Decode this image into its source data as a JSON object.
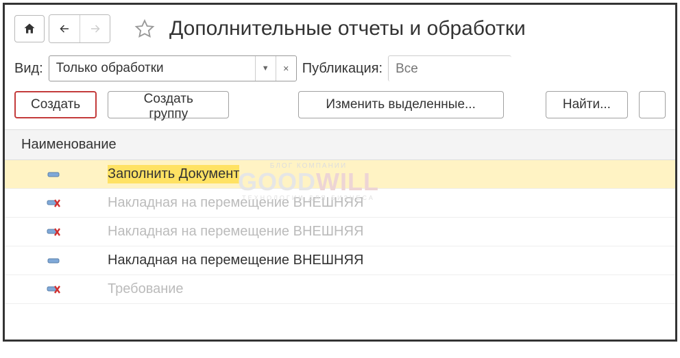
{
  "header": {
    "title": "Дополнительные отчеты и обработки"
  },
  "filter": {
    "type_label": "Вид:",
    "type_value": "Только обработки",
    "pub_label": "Публикация:",
    "pub_placeholder": "Все"
  },
  "toolbar": {
    "create": "Создать",
    "create_group": "Создать группу",
    "change_selected": "Изменить выделенные...",
    "find": "Найти..."
  },
  "table": {
    "header": "Наименование",
    "rows": [
      {
        "icon": "minus",
        "text": "Заполнить Документ",
        "selected": true,
        "dim": false
      },
      {
        "icon": "del",
        "text": "Накладная на перемещение ВНЕШНЯЯ",
        "selected": false,
        "dim": true
      },
      {
        "icon": "del",
        "text": "Накладная на перемещение ВНЕШНЯЯ",
        "selected": false,
        "dim": true
      },
      {
        "icon": "minus",
        "text": "Накладная на перемещение ВНЕШНЯЯ",
        "selected": false,
        "dim": false
      },
      {
        "icon": "del",
        "text": "Требование",
        "selected": false,
        "dim": true
      }
    ]
  },
  "watermark": {
    "top": "БЛОГ КОМПАНИИ",
    "brand1": "GOOD",
    "brand2": "WILL",
    "sub": "ТЕХНОЛОГИИ ДЛЯ БИЗНЕСА"
  }
}
